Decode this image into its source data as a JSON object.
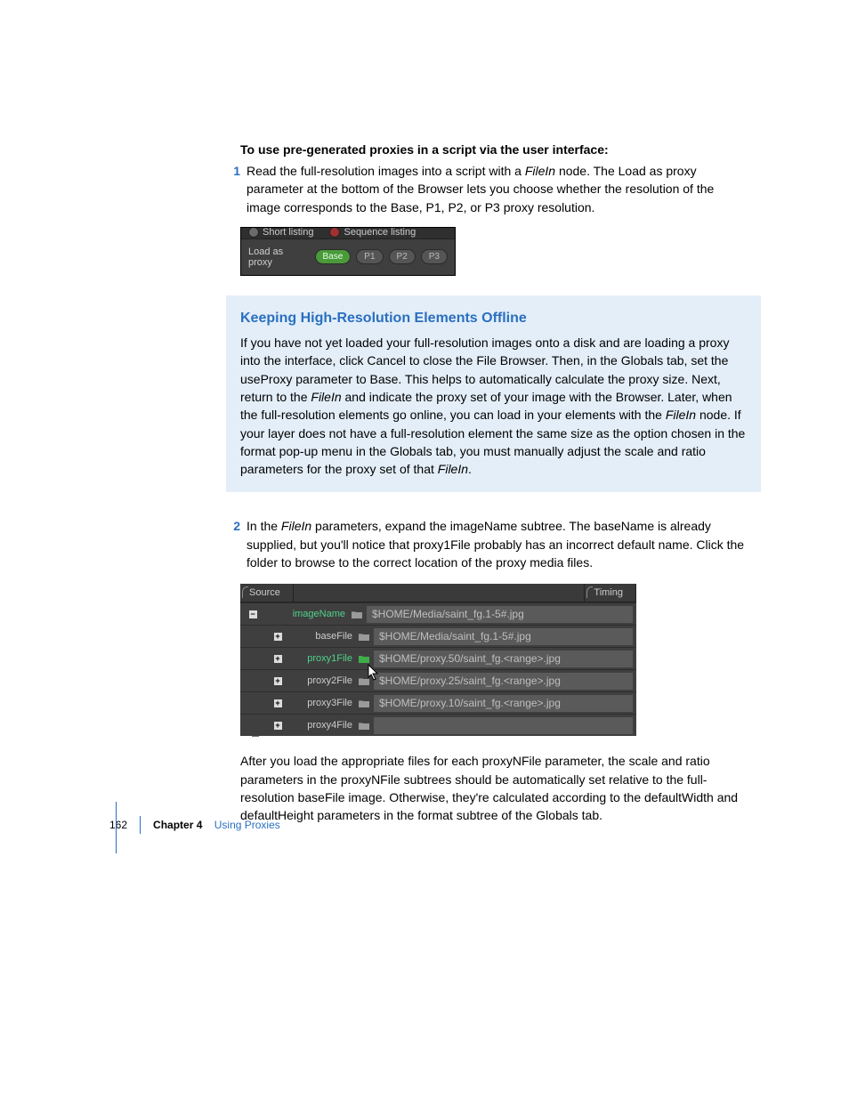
{
  "heading": "To use pre-generated proxies in a script via the user interface:",
  "step1": {
    "num": "1",
    "text_a": "Read the full-resolution images into a script with a ",
    "italic1": "FileIn",
    "text_b": " node. The Load as proxy parameter at the bottom of the Browser lets you choose whether the resolution of the image corresponds to the Base, P1, P2, or P3 proxy resolution."
  },
  "shot1": {
    "top_left": "Short listing",
    "top_right": "Sequence listing",
    "label": "Load as proxy",
    "btn_base": "Base",
    "btn_p1": "P1",
    "btn_p2": "P2",
    "btn_p3": "P3"
  },
  "callout": {
    "title": "Keeping High-Resolution Elements Offline",
    "t1": "If you have not yet loaded your full-resolution images onto a disk and are loading a proxy into the interface, click Cancel to close the File Browser. Then, in the Globals tab, set the useProxy parameter to Base. This helps to automatically calculate the proxy size. Next, return to the ",
    "i1": "FileIn",
    "t2": " and indicate the proxy set of your image with the Browser. Later, when the full-resolution elements go online, you can load in your elements with the ",
    "i2": "FileIn",
    "t3": " node. If your layer does not have a full-resolution element the same size as the option chosen in the format pop-up menu in the Globals tab, you must manually adjust the scale and ratio parameters for the proxy set of that ",
    "i3": "FileIn",
    "t4": "."
  },
  "step2": {
    "num": "2",
    "t1": "In the ",
    "i1": "FileIn",
    "t2": " parameters, expand the imageName subtree. The baseName is already supplied, but you'll notice that proxy1File probably has an incorrect default name. Click the folder to browse to the correct location of the proxy media files."
  },
  "shot2": {
    "tab_source": "Source",
    "tab_timing": "Timing",
    "rows": {
      "imageName": {
        "label": "imageName",
        "value": "$HOME/Media/saint_fg.1-5#.jpg"
      },
      "baseFile": {
        "label": "baseFile",
        "value": "$HOME/Media/saint_fg.1-5#.jpg"
      },
      "proxy1": {
        "label": "proxy1File",
        "value": "$HOME/proxy.50/saint_fg.<range>.jpg"
      },
      "proxy2": {
        "label": "proxy2File",
        "value": "$HOME/proxy.25/saint_fg.<range>.jpg"
      },
      "proxy3": {
        "label": "proxy3File",
        "value": "$HOME/proxy.10/saint_fg.<range>.jpg"
      },
      "proxy4": {
        "label": "proxy4File",
        "value": ""
      }
    }
  },
  "para_after": "After you load the appropriate files for each proxyNFile parameter, the scale and ratio parameters in the proxyNFile subtrees should be automatically set relative to the full-resolution baseFile image. Otherwise, they're calculated according to the defaultWidth and defaultHeight parameters in the format subtree of the Globals tab.",
  "footer": {
    "page": "162",
    "chapter": "Chapter 4",
    "title": "Using Proxies"
  }
}
